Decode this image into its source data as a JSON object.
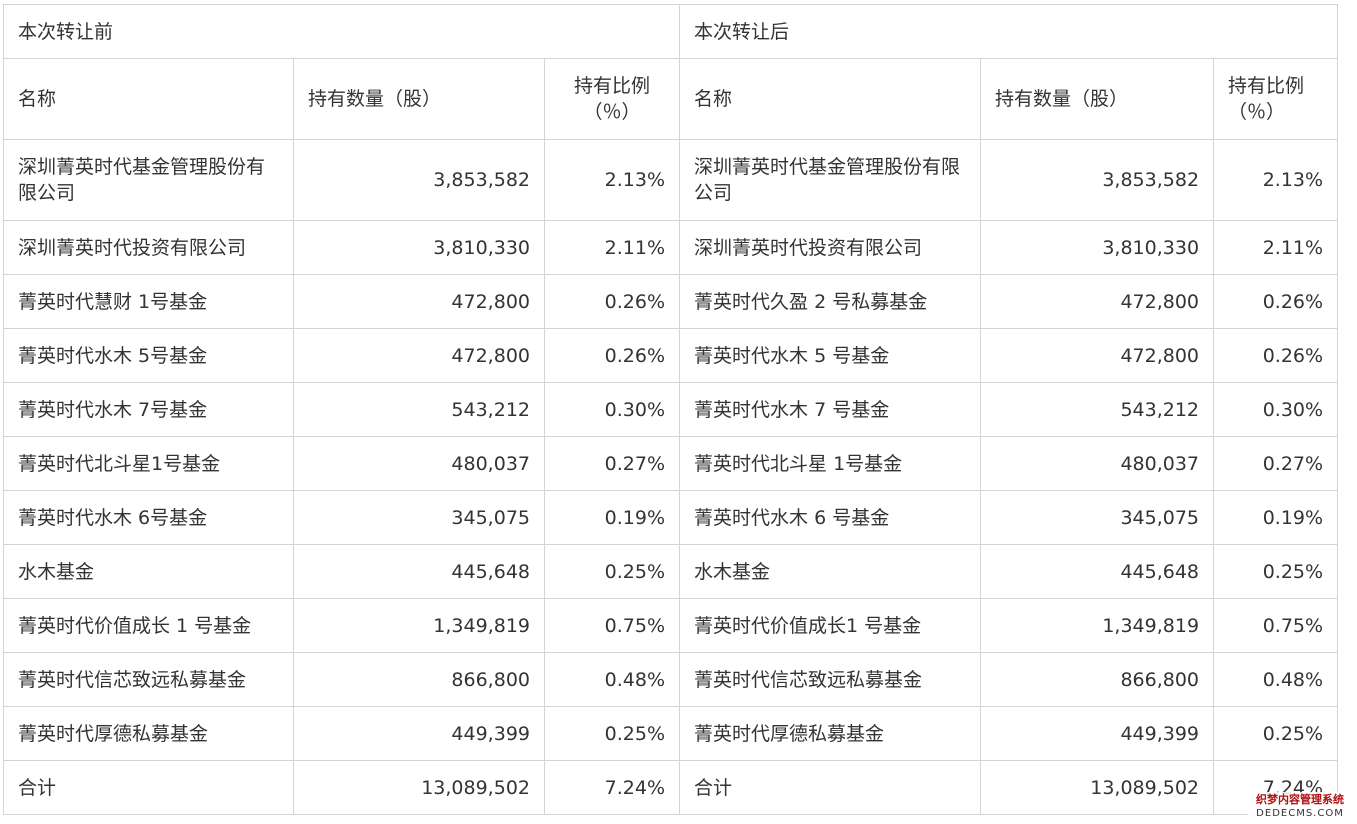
{
  "table": {
    "group_before": "本次转让前",
    "group_after": "本次转让后",
    "headers_before": {
      "name": "名称",
      "quantity": "持有数量（股）",
      "ratio": "持有比例（％）"
    },
    "headers_after": {
      "name": "名称",
      "quantity": "持有数量（股）",
      "ratio": "持有比例（％）"
    },
    "rows": [
      {
        "before": {
          "name": "深圳菁英时代基金管理股份有限公司",
          "quantity": "3,853,582",
          "ratio": "2.13%"
        },
        "after": {
          "name": "深圳菁英时代基金管理股份有限公司",
          "quantity": "3,853,582",
          "ratio": "2.13%"
        }
      },
      {
        "before": {
          "name": "深圳菁英时代投资有限公司",
          "quantity": "3,810,330",
          "ratio": "2.11%"
        },
        "after": {
          "name": "深圳菁英时代投资有限公司",
          "quantity": "3,810,330",
          "ratio": "2.11%"
        }
      },
      {
        "before": {
          "name": "菁英时代慧财 1号基金",
          "quantity": "472,800",
          "ratio": "0.26%"
        },
        "after": {
          "name": "菁英时代久盈 2 号私募基金",
          "quantity": "472,800",
          "ratio": "0.26%"
        }
      },
      {
        "before": {
          "name": "菁英时代水木 5号基金",
          "quantity": "472,800",
          "ratio": "0.26%"
        },
        "after": {
          "name": "菁英时代水木 5 号基金",
          "quantity": "472,800",
          "ratio": "0.26%"
        }
      },
      {
        "before": {
          "name": "菁英时代水木 7号基金",
          "quantity": "543,212",
          "ratio": "0.30%"
        },
        "after": {
          "name": "菁英时代水木 7 号基金",
          "quantity": "543,212",
          "ratio": "0.30%"
        }
      },
      {
        "before": {
          "name": "菁英时代北斗星1号基金",
          "quantity": "480,037",
          "ratio": "0.27%"
        },
        "after": {
          "name": "菁英时代北斗星 1号基金",
          "quantity": "480,037",
          "ratio": "0.27%"
        }
      },
      {
        "before": {
          "name": "菁英时代水木 6号基金",
          "quantity": "345,075",
          "ratio": "0.19%"
        },
        "after": {
          "name": "菁英时代水木 6 号基金",
          "quantity": "345,075",
          "ratio": "0.19%"
        }
      },
      {
        "before": {
          "name": "水木基金",
          "quantity": "445,648",
          "ratio": "0.25%"
        },
        "after": {
          "name": "水木基金",
          "quantity": "445,648",
          "ratio": "0.25%"
        }
      },
      {
        "before": {
          "name": "菁英时代价值成长 1 号基金",
          "quantity": "1,349,819",
          "ratio": "0.75%"
        },
        "after": {
          "name": "菁英时代价值成长1 号基金",
          "quantity": "1,349,819",
          "ratio": "0.75%"
        }
      },
      {
        "before": {
          "name": "菁英时代信芯致远私募基金",
          "quantity": "866,800",
          "ratio": "0.48%"
        },
        "after": {
          "name": "菁英时代信芯致远私募基金",
          "quantity": "866,800",
          "ratio": "0.48%"
        }
      },
      {
        "before": {
          "name": "菁英时代厚德私募基金",
          "quantity": "449,399",
          "ratio": "0.25%"
        },
        "after": {
          "name": "菁英时代厚德私募基金",
          "quantity": "449,399",
          "ratio": "0.25%"
        }
      }
    ],
    "total": {
      "before": {
        "name": "合计",
        "quantity": "13,089,502",
        "ratio": "7.24%"
      },
      "after": {
        "name": "合计",
        "quantity": "13,089,502",
        "ratio": "7.24%"
      }
    }
  },
  "watermark": {
    "cn": "织梦内容管理系统",
    "en": "DEDECMS.COM"
  }
}
